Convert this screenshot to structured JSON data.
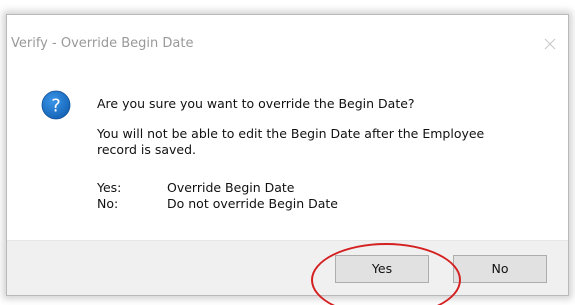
{
  "dialog": {
    "title": "Verify - Override Begin Date",
    "icon": "question-icon",
    "message_line1": "Are you sure you want to override the Begin Date?",
    "message_line2": "You will not be able to edit the Begin Date after the Employee",
    "message_line3": "record is saved.",
    "options": [
      {
        "key": "Yes:",
        "value": "Override Begin Date"
      },
      {
        "key": "No:",
        "value": "Do not override Begin Date"
      }
    ],
    "buttons": {
      "yes_label": "Yes",
      "no_label": "No"
    }
  },
  "colors": {
    "icon_blue": "#1a73c9",
    "highlight_red": "#d42020",
    "footer_bg": "#f0f0f0"
  }
}
